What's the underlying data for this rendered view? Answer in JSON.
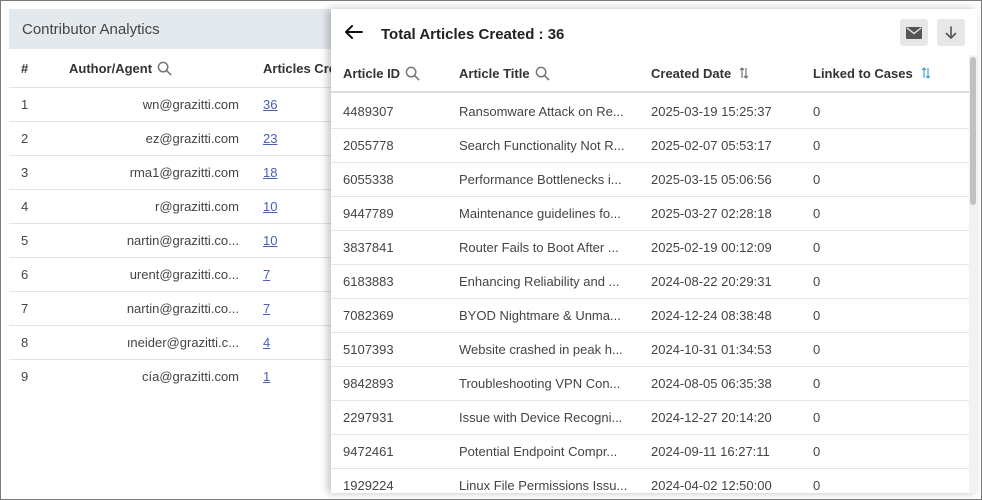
{
  "background_panel": {
    "title": "Contributor Analytics",
    "columns": {
      "num": "#",
      "author": "Author/Agent",
      "articles": "Articles Cre"
    },
    "rows": [
      {
        "num": "1",
        "author": "wn@grazitti.com",
        "articles": "36"
      },
      {
        "num": "2",
        "author": "ez@grazitti.com",
        "articles": "23"
      },
      {
        "num": "3",
        "author": "rma1@grazitti.com",
        "articles": "18"
      },
      {
        "num": "4",
        "author": "r@grazitti.com",
        "articles": "10"
      },
      {
        "num": "5",
        "author": "nartin@grazitti.co...",
        "articles": "10"
      },
      {
        "num": "6",
        "author": "urent@grazitti.co...",
        "articles": "7"
      },
      {
        "num": "7",
        "author": "nartin@grazitti.co...",
        "articles": "7"
      },
      {
        "num": "8",
        "author": "ıneider@grazitti.c...",
        "articles": "4"
      },
      {
        "num": "9",
        "author": "cía@grazitti.com",
        "articles": "1"
      }
    ]
  },
  "drawer": {
    "title": "Total Articles Created : 36",
    "columns": {
      "id": "Article ID",
      "title": "Article Title",
      "date": "Created Date",
      "linked": "Linked to Cases"
    },
    "rows": [
      {
        "id": "4489307",
        "title": "Ransomware Attack on Re...",
        "date": "2025-03-19 15:25:37",
        "linked": "0"
      },
      {
        "id": "2055778",
        "title": "Search Functionality Not R...",
        "date": "2025-02-07 05:53:17",
        "linked": "0"
      },
      {
        "id": "6055338",
        "title": "Performance Bottlenecks i...",
        "date": "2025-03-15 05:06:56",
        "linked": "0"
      },
      {
        "id": "9447789",
        "title": "Maintenance guidelines fo...",
        "date": "2025-03-27 02:28:18",
        "linked": "0"
      },
      {
        "id": "3837841",
        "title": "Router Fails to Boot After ...",
        "date": "2025-02-19 00:12:09",
        "linked": "0"
      },
      {
        "id": "6183883",
        "title": "Enhancing Reliability and ...",
        "date": "2024-08-22 20:29:31",
        "linked": "0"
      },
      {
        "id": "7082369",
        "title": "BYOD Nightmare & Unma...",
        "date": "2024-12-24 08:38:48",
        "linked": "0"
      },
      {
        "id": "5107393",
        "title": "Website crashed in peak h...",
        "date": "2024-10-31 01:34:53",
        "linked": "0"
      },
      {
        "id": "9842893",
        "title": "Troubleshooting VPN Con...",
        "date": "2024-08-05 06:35:38",
        "linked": "0"
      },
      {
        "id": "2297931",
        "title": "Issue with Device Recogni...",
        "date": "2024-12-27 20:14:20",
        "linked": "0"
      },
      {
        "id": "9472461",
        "title": "Potential Endpoint Compr...",
        "date": "2024-09-11 16:27:11",
        "linked": "0"
      },
      {
        "id": "1929224",
        "title": "Linux File Permissions Issu...",
        "date": "2024-04-02 12:50:00",
        "linked": "0"
      }
    ]
  },
  "icons": {
    "back": "arrow-left-icon",
    "mail": "mail-icon",
    "download": "download-icon",
    "search": "search-icon",
    "sort": "sort-icon"
  },
  "colors": {
    "link": "#4a5fb5",
    "header_bg": "#e4e9ed",
    "sort_active": "#3a9ad9"
  }
}
